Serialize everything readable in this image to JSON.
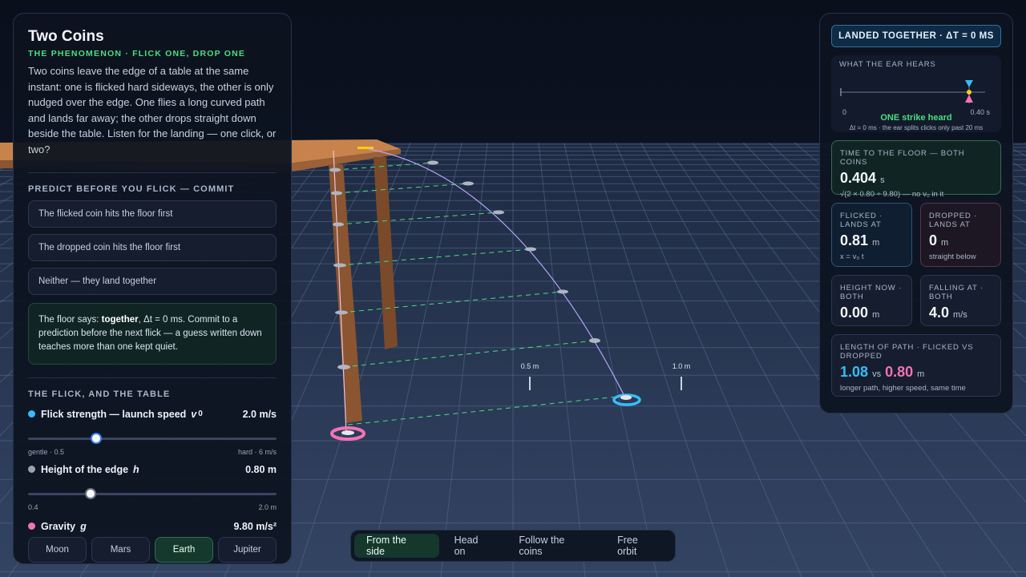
{
  "scene": {
    "marker_near": "0.5 m",
    "marker_far": "1.0 m"
  },
  "left": {
    "title": "Two Coins",
    "subtitle": "THE PHENOMENON · FLICK ONE, DROP ONE",
    "intro": "Two coins leave the edge of a table at the same instant: one is flicked hard sideways, the other is only nudged over the edge. One flies a long curved path and lands far away; the other drops straight down beside the table. Listen for the landing — one click, or two?",
    "predict_title": "PREDICT BEFORE YOU FLICK — COMMIT",
    "options": [
      "The flicked coin hits the floor first",
      "The dropped coin hits the floor first",
      "Neither — they land together"
    ],
    "verdict_pre": "The floor says: ",
    "verdict_bold": "together",
    "verdict_post": ", Δt = 0 ms. Commit to a prediction before the next flick — a guess written down teaches more than one kept quiet.",
    "controls_title": "THE FLICK, AND THE TABLE",
    "flick": {
      "label": "Flick strength — launch speed",
      "symbol": "v",
      "subscript": "0",
      "value": "2.0 m/s",
      "min_label": "gentle · 0.5",
      "max_label": "hard · 6 m/s",
      "fraction": 0.273
    },
    "height": {
      "label": "Height of the edge",
      "symbol": "h",
      "value": "0.80 m",
      "min_label": "0.4",
      "max_label": "2.0 m",
      "fraction": 0.25
    },
    "gravity": {
      "label": "Gravity",
      "symbol": "g",
      "value": "9.80 m/s²"
    },
    "planets": [
      "Moon",
      "Mars",
      "Earth",
      "Jupiter"
    ],
    "active_planet": "Earth"
  },
  "right": {
    "badge": "LANDED TOGETHER · ΔT = 0 MS",
    "ear_title": "WHAT THE EAR HEARS",
    "ear_axis_min": "0",
    "ear_axis_max": "0.40 s",
    "ear_result": "ONE strike heard",
    "ear_note": "Δt = 0 ms · the ear splits clicks only past 20 ms",
    "time_title": "TIME TO THE FLOOR — BOTH COINS",
    "time_value": "0.404",
    "time_unit": "s",
    "time_formula": "√(2 × 0.80 ÷ 9.80) — no v₀ in it",
    "flicked_title": "FLICKED · LANDS AT",
    "flicked_value": "0.81",
    "flicked_unit": "m",
    "flicked_note": "x = v₀ t",
    "dropped_title": "DROPPED · LANDS AT",
    "dropped_value": "0",
    "dropped_unit": "m",
    "dropped_note": "straight below",
    "height_title": "HEIGHT NOW · BOTH",
    "height_value": "0.00",
    "height_unit": "m",
    "falling_title": "FALLING AT · BOTH",
    "falling_value": "4.0",
    "falling_unit": "m/s",
    "path_title": "LENGTH OF PATH · FLICKED VS DROPPED",
    "path_flicked": "1.08",
    "path_vs": "vs",
    "path_dropped": "0.80",
    "path_unit": "m",
    "path_note": "longer path, higher speed, same time"
  },
  "views": [
    "From the side",
    "Head on",
    "Follow the coins",
    "Free orbit"
  ],
  "active_view": "From the side",
  "colors": {
    "flicked": "#38bdf8",
    "dropped": "#f472b6",
    "accent_green": "#4ade80"
  }
}
